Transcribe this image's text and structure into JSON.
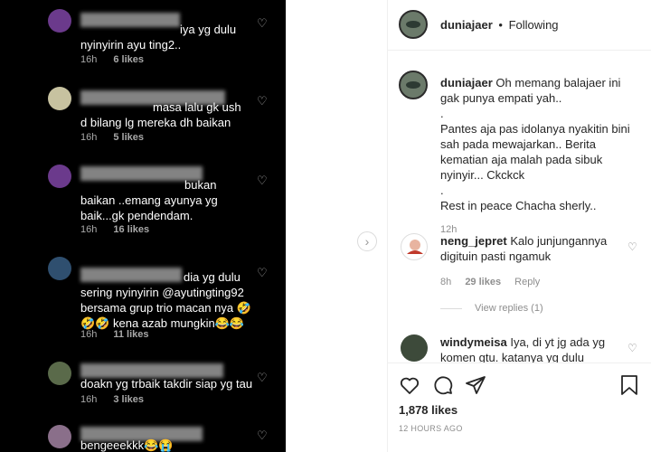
{
  "left_comments": [
    {
      "text": "iya yg dulu\nnyinyirin ayu ting2..",
      "time": "16h",
      "likes": "6 likes"
    },
    {
      "text": "masa lalu gk ush\nd bilang lg mereka dh baikan",
      "time": "16h",
      "likes": "5 likes"
    },
    {
      "text": "bukan\nbaikan ..emang ayunya yg\nbaik...gk pendendam.",
      "time": "16h",
      "likes": "16 likes"
    },
    {
      "text": "dia yg dulu\nsering nyinyirin @ayutingting92\nbersama grup trio macan nya 🤣\n🤣🤣 kena azab mungkin😂😂",
      "time": "16h",
      "likes": "11 likes"
    },
    {
      "text": "doakn yg trbaik takdir siap yg tau",
      "time": "16h",
      "likes": "3 likes"
    },
    {
      "text": "bengeeekkk😂😭",
      "time": "",
      "likes": ""
    }
  ],
  "header": {
    "username": "duniajaer",
    "separator": "•",
    "follow_status": "Following"
  },
  "caption": {
    "username": "duniajaer",
    "text": "Oh memang balajaer ini gak punya empati yah..\n.\nPantes aja pas idolanya nyakitin bini sah pada mewajarkan.. Berita kematian aja malah pada sibuk nyinyir... Ckckck\n.\nRest in peace Chacha sherly..",
    "time": "12h"
  },
  "comments": [
    {
      "username": "neng_jepret",
      "text": "Kalo junjungannya digituin pasti ngamuk",
      "time": "8h",
      "likes": "29 likes",
      "reply": "Reply"
    },
    {
      "username": "windymeisa",
      "text": "Iya, di yt jg ada yg komen gtu. katanya yg dulu",
      "time": "",
      "likes": "",
      "reply": ""
    }
  ],
  "view_replies": "View replies (1)",
  "likes_count": "1,878 likes",
  "posted_time": "12 HOURS AGO",
  "icons": [
    "heart-icon",
    "comment-icon",
    "share-icon",
    "bookmark-icon",
    "chevron-right-icon"
  ]
}
